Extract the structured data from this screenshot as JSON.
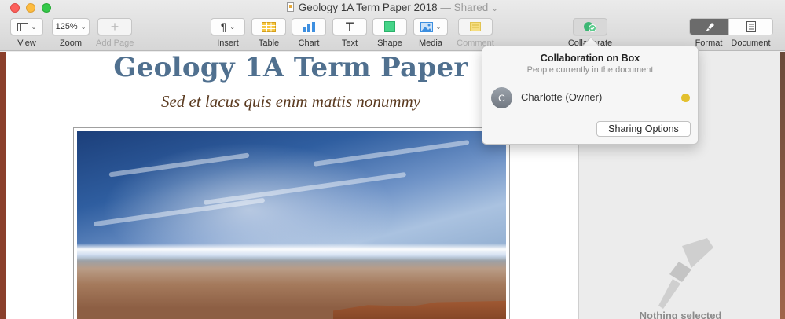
{
  "window": {
    "title": "Geology 1A Term Paper 2018",
    "title_separator": " — ",
    "title_status": "Shared",
    "title_chevron": "⌄"
  },
  "toolbar": {
    "view_label": "View",
    "zoom_value": "125%",
    "zoom_label": "Zoom",
    "add_page_label": "Add Page",
    "insert_label": "Insert",
    "insert_glyph": "¶",
    "table_label": "Table",
    "chart_label": "Chart",
    "text_label": "Text",
    "text_glyph": "T",
    "shape_label": "Shape",
    "media_label": "Media",
    "comment_label": "Comment",
    "collaborate_label": "Collaborate",
    "format_label": "Format",
    "document_label": "Document",
    "chevron_glyph": "⌄",
    "plus_glyph": "+"
  },
  "document": {
    "title": "Geology 1A Term Paper",
    "subtitle": "Sed et lacus quis enim mattis nonummy"
  },
  "collaboration_popover": {
    "title": "Collaboration on Box",
    "subtitle": "People currently in the document",
    "participants": [
      {
        "initial": "C",
        "name": "Charlotte (Owner)",
        "presence_color": "#e3c02d"
      }
    ],
    "sharing_button": "Sharing Options"
  },
  "sidebar": {
    "empty_state": "Nothing selected"
  },
  "colors": {
    "title_blue": "#50708f",
    "subtitle_brown": "#5a3a20",
    "collaborate_green": "#3db774"
  }
}
